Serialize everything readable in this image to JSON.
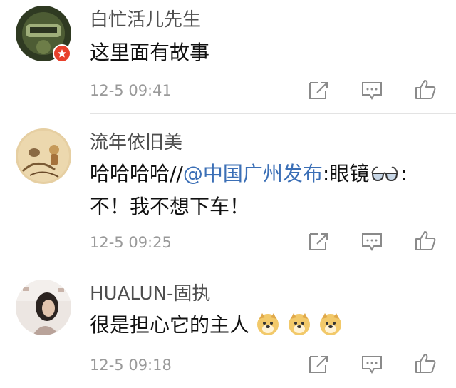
{
  "comments": [
    {
      "username": "白忙活儿先生",
      "text": "这里面有故事",
      "time": "12-5 09:41"
    },
    {
      "username": "流年依旧美",
      "text_prefix": "哈哈哈哈//",
      "mention": "@中国广州发布",
      "text_mid": ":眼镜",
      "text_mid_after": ":",
      "text_line2": "不！我不想下车！",
      "time": "12-5 09:25"
    },
    {
      "username": "HUALUN-固执",
      "text": "很是担心它的主人",
      "time": "12-5 09:18"
    }
  ],
  "icons": {
    "repost": "repost-icon",
    "comment": "comment-icon",
    "like": "like-icon",
    "emoji": "doge-emoji",
    "glasses": "glasses-emoji",
    "verified": "verified-badge"
  },
  "colors": {
    "mention": "#3b6fb6",
    "badge": "#e8412c",
    "username": "#4e4e4e",
    "time": "#9a9a9a"
  }
}
